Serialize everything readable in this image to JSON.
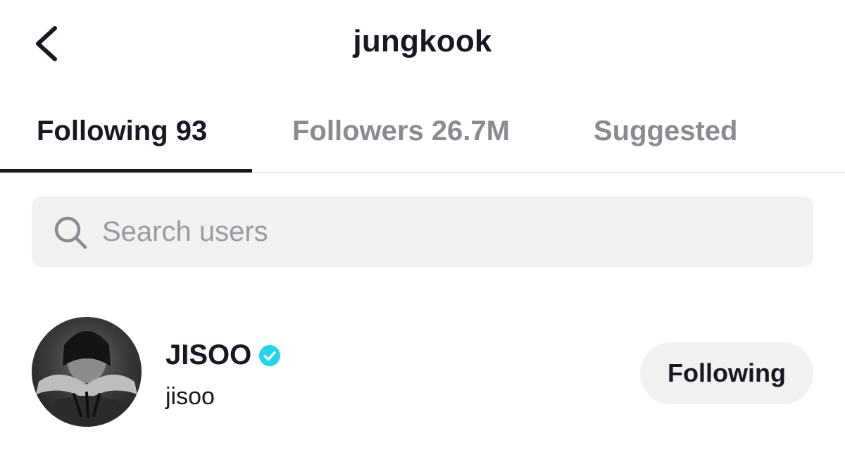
{
  "header": {
    "title": "jungkook",
    "back_icon": "chevron-left-icon"
  },
  "tabs": [
    {
      "label": "Following 93",
      "active": true
    },
    {
      "label": "Followers 26.7M",
      "active": false
    },
    {
      "label": "Suggested",
      "active": false
    }
  ],
  "search": {
    "placeholder": "Search users",
    "value": "",
    "icon": "search-icon"
  },
  "users": [
    {
      "name": "JISOO",
      "handle": "jisoo",
      "verified": true,
      "button_label": "Following"
    }
  ],
  "colors": {
    "text_primary": "#161823",
    "text_secondary": "#8a8b91",
    "verified_badge": "#20d5ec",
    "surface": "#f1f1f2"
  }
}
